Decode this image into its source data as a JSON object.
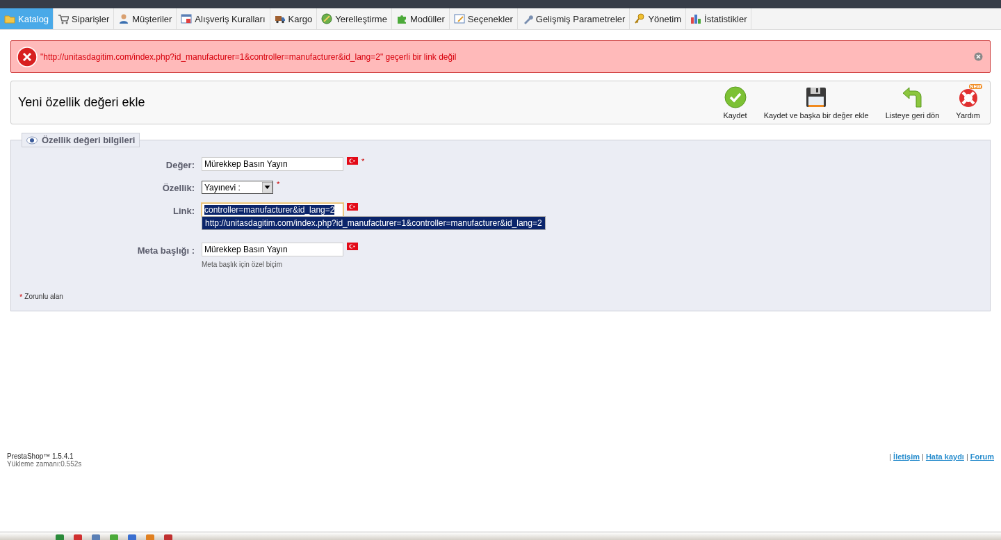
{
  "tabs": [
    {
      "label": "Katalog",
      "kind": "folder",
      "selected": true
    },
    {
      "label": "Siparişler",
      "kind": "cart",
      "selected": false
    },
    {
      "label": "Müşteriler",
      "kind": "person",
      "selected": false
    },
    {
      "label": "Alışveriş Kuralları",
      "kind": "window",
      "selected": false
    },
    {
      "label": "Kargo",
      "kind": "truck",
      "selected": false
    },
    {
      "label": "Yerelleştirme",
      "kind": "globe",
      "selected": false
    },
    {
      "label": "Modüller",
      "kind": "puzzle",
      "selected": false
    },
    {
      "label": "Seçenekler",
      "kind": "form",
      "selected": false
    },
    {
      "label": "Gelişmiş Parametreler",
      "kind": "wrench",
      "selected": false
    },
    {
      "label": "Yönetim",
      "kind": "key",
      "selected": false
    },
    {
      "label": "İstatistikler",
      "kind": "chart",
      "selected": false
    }
  ],
  "error": {
    "message": "\"http://unitasdagitim.com/index.php?id_manufacturer=1&controller=manufacturer&id_lang=2\" geçerli bir link değil"
  },
  "toolbar": {
    "title": "Yeni özellik değeri ekle",
    "buttons": [
      {
        "label": "Kaydet",
        "kind": "save"
      },
      {
        "label": "Kaydet ve başka bir değer ekle",
        "kind": "disk"
      },
      {
        "label": "Listeye geri dön",
        "kind": "back"
      },
      {
        "label": "Yardım",
        "kind": "help",
        "badge": "NEW"
      }
    ]
  },
  "form": {
    "legend": "Özellik değeri bilgileri",
    "fields": [
      {
        "label": "Değer:",
        "kind": "text",
        "value": "Mürekkep Basın Yayın",
        "required_mark": "*"
      },
      {
        "label": "Özellik:",
        "kind": "select",
        "value": "Yayınevi :",
        "required_mark": "*"
      },
      {
        "label": "Link:",
        "kind": "text",
        "value": "controller=manufacturer&id_lang=2",
        "focused": true,
        "text_selected": true,
        "suggestion": "http://unitasdagitim.com/index.php?id_manufacturer=1&controller=manufacturer&id_lang=2"
      },
      {
        "label": "Meta başlığı :",
        "kind": "text",
        "value": "Mürekkep Basın Yayın",
        "hint": "Meta başlık için özel biçim"
      }
    ],
    "required_note": {
      "mark": "*",
      "text": "Zorunlu alan"
    }
  },
  "footer": {
    "version": "PrestaShop™ 1.5.4.1",
    "load_time": "Yükleme zamanı:0.552s",
    "separator": "|",
    "links": [
      "İletişim",
      "Hata kaydı",
      "Forum"
    ]
  }
}
